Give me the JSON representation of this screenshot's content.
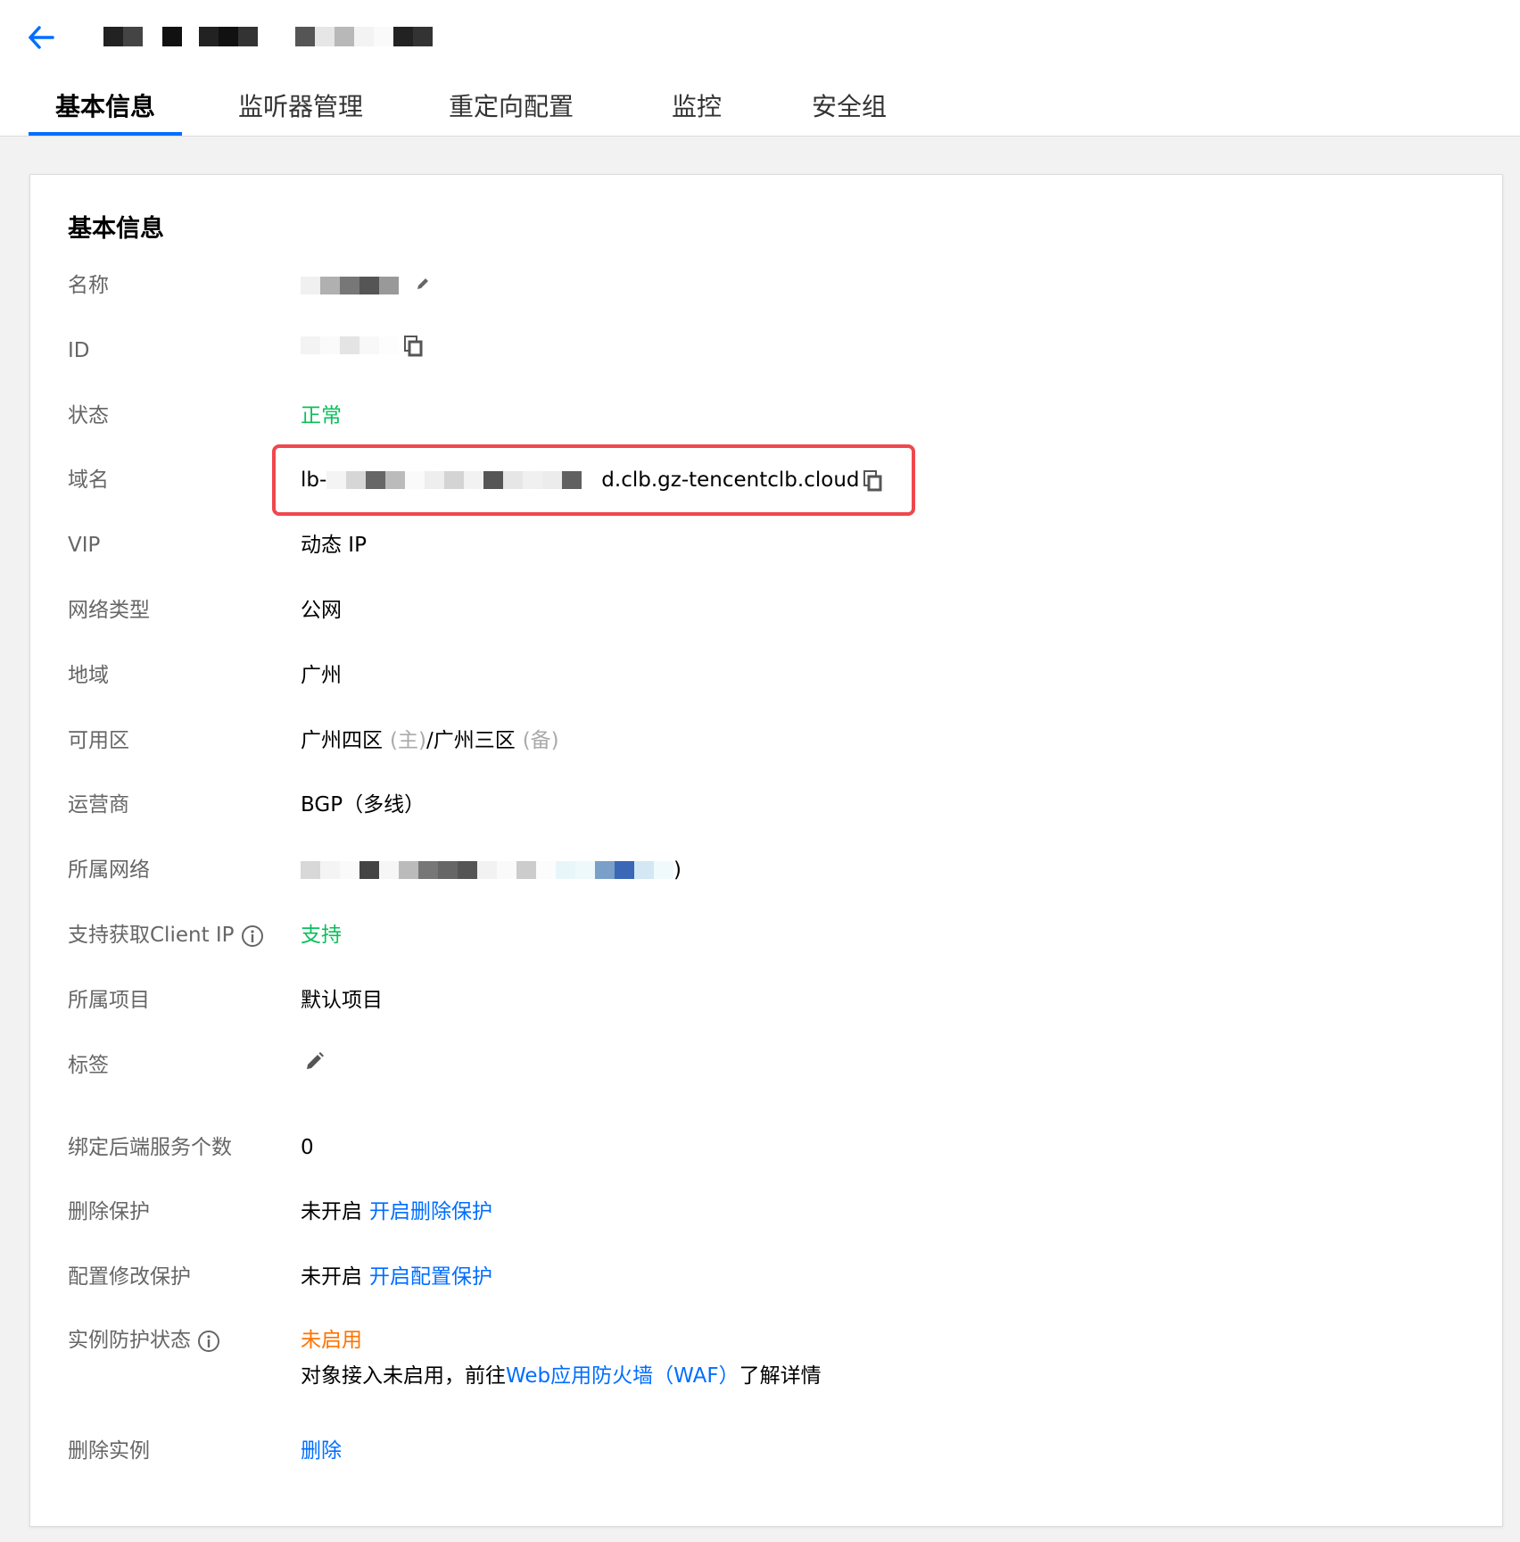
{
  "tabs": [
    {
      "label": "基本信息"
    },
    {
      "label": "监听器管理"
    },
    {
      "label": "重定向配置"
    },
    {
      "label": "监控"
    },
    {
      "label": "安全组"
    }
  ],
  "card": {
    "title": "基本信息",
    "fields": {
      "name": {
        "label": "名称"
      },
      "id": {
        "label": "ID"
      },
      "status": {
        "label": "状态",
        "value": "正常"
      },
      "domain": {
        "label": "域名",
        "prefix": "lb-",
        "suffix": "d.clb.gz-tencentclb.cloud"
      },
      "vip": {
        "label": "VIP",
        "value": "动态 IP"
      },
      "network_type": {
        "label": "网络类型",
        "value": "公网"
      },
      "region": {
        "label": "地域",
        "value": "广州"
      },
      "zone": {
        "label": "可用区",
        "primary": "广州四区",
        "primary_tag": "(主)",
        "sep": "/",
        "backup": "广州三区",
        "backup_tag": "(备)"
      },
      "isp": {
        "label": "运营商",
        "value": "BGP（多线）"
      },
      "vpc": {
        "label": "所属网络",
        "tail": ")"
      },
      "client_ip": {
        "label": "支持获取Client IP",
        "value": "支持"
      },
      "project": {
        "label": "所属项目",
        "value": "默认项目"
      },
      "tags": {
        "label": "标签"
      },
      "backend_count": {
        "label": "绑定后端服务个数",
        "value": "0"
      },
      "delete_protection": {
        "label": "删除保护",
        "status": "未开启",
        "action": "开启删除保护"
      },
      "config_protection": {
        "label": "配置修改保护",
        "status": "未开启",
        "action": "开启配置保护"
      },
      "instance_protection": {
        "label": "实例防护状态",
        "status": "未启用",
        "desc_before": "对象接入未启用，前往",
        "desc_link": "Web应用防火墙（WAF）",
        "desc_after": "了解详情"
      },
      "delete_instance": {
        "label": "删除实例",
        "action": "删除"
      }
    }
  },
  "colors": {
    "accent": "#006eff",
    "success": "#0abf5b",
    "warning": "#ff7200",
    "highlight_box": "#f0474d"
  }
}
